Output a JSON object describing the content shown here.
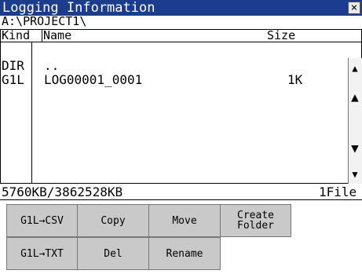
{
  "window": {
    "title": "Logging Information",
    "close_glyph": "×"
  },
  "path": "A:\\PROJECT1\\",
  "columns": {
    "kind": "Kind",
    "name": "Name",
    "size": "Size"
  },
  "rows": [
    {
      "kind": "DIR",
      "name": "..",
      "size": ""
    },
    {
      "kind": "G1L",
      "name": "LOG00001_0001",
      "size": "1K"
    }
  ],
  "scrollbar": {
    "page_up": "▲",
    "up": "▲",
    "down": "▼",
    "page_down": "▼"
  },
  "status": {
    "capacity": "5760KB/3862528KB",
    "file_count": "1File"
  },
  "buttons": {
    "g1l_csv": "G1L→CSV",
    "copy": "Copy",
    "move": "Move",
    "create_folder": "Create\nFolder",
    "g1l_txt": "G1L→TXT",
    "del": "Del",
    "rename": "Rename"
  }
}
